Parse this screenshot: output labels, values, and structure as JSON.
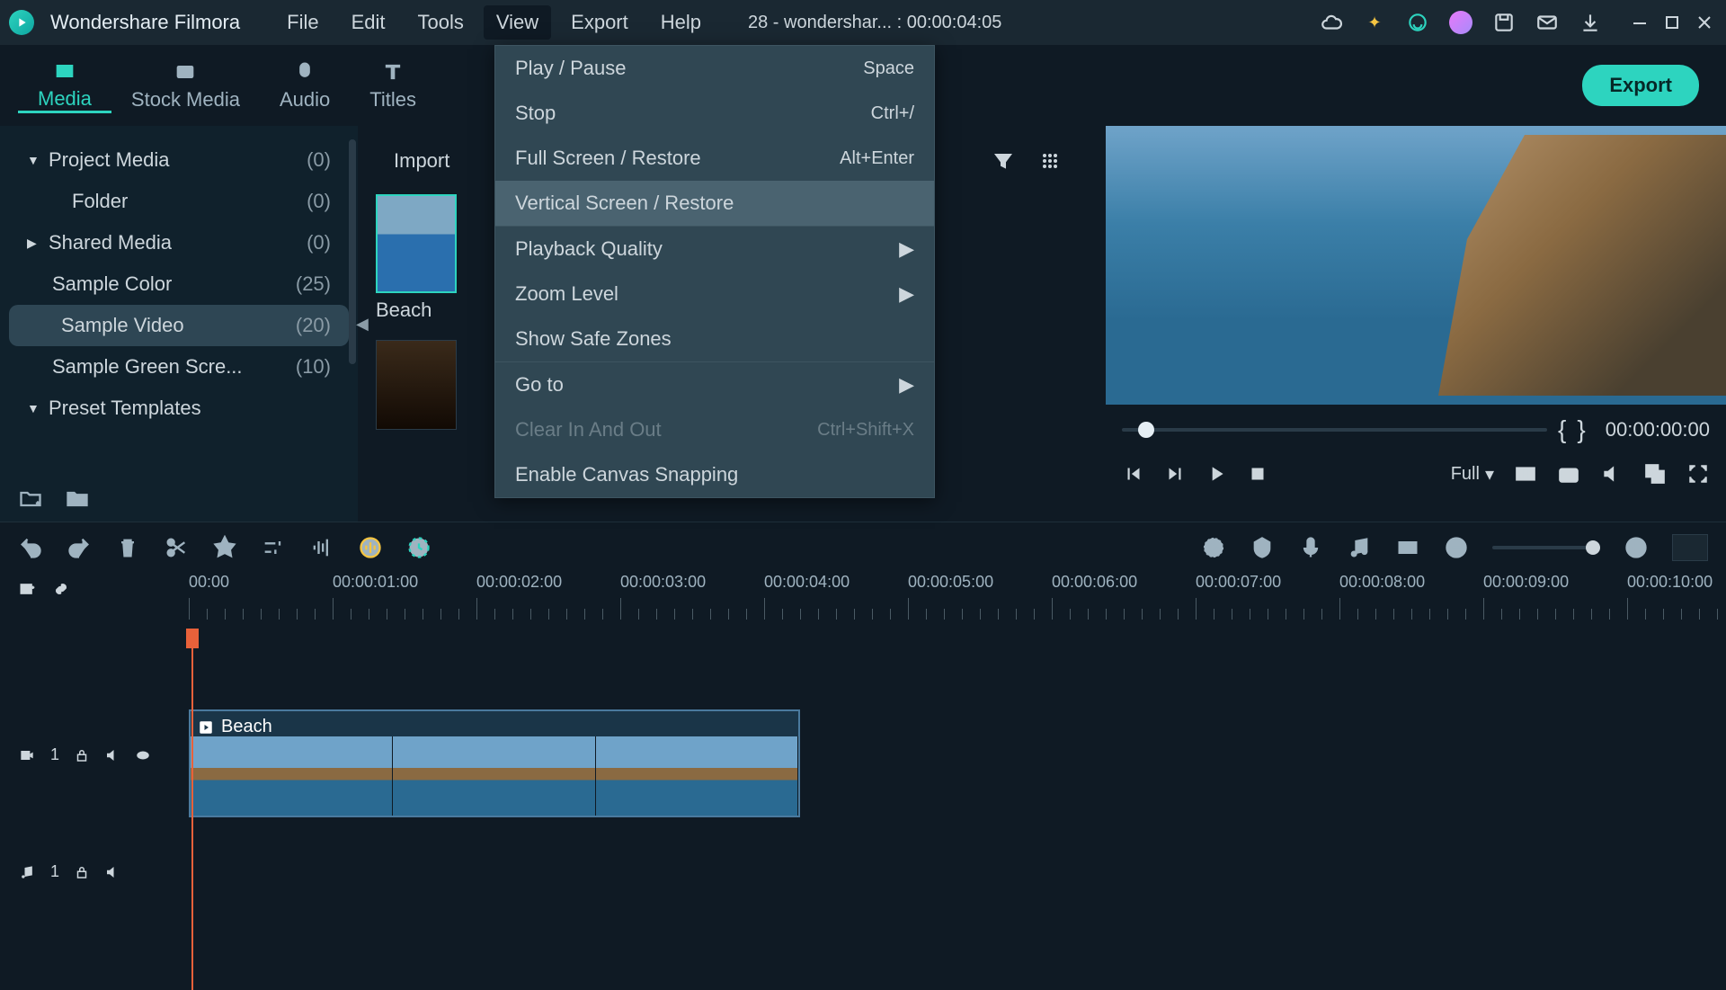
{
  "app": {
    "name": "Wondershare Filmora",
    "doc": "28 - wondershar... : 00:00:04:05"
  },
  "menubar": [
    "File",
    "Edit",
    "Tools",
    "View",
    "Export",
    "Help"
  ],
  "tabs": [
    {
      "label": "Media",
      "active": true
    },
    {
      "label": "Stock Media"
    },
    {
      "label": "Audio"
    },
    {
      "label": "Titles"
    }
  ],
  "export_label": "Export",
  "sidebar": {
    "items": [
      {
        "label": "Project Media",
        "count": "(0)",
        "arrow": "▼"
      },
      {
        "label": "Folder",
        "count": "(0)",
        "sub": true
      },
      {
        "label": "Shared Media",
        "count": "(0)",
        "arrow": "▶"
      },
      {
        "label": "Sample Color",
        "count": "(25)",
        "sub2": true
      },
      {
        "label": "Sample Video",
        "count": "(20)",
        "sub2": true,
        "selected": true
      },
      {
        "label": "Sample Green Scre...",
        "count": "(10)",
        "sub2": true
      },
      {
        "label": "Preset Templates",
        "arrow": "▼"
      }
    ]
  },
  "media": {
    "import": "Import",
    "thumb1": "Beach"
  },
  "dropdown": [
    {
      "label": "Play / Pause",
      "shortcut": "Space"
    },
    {
      "label": "Stop",
      "shortcut": "Ctrl+/"
    },
    {
      "label": "Full Screen / Restore",
      "shortcut": "Alt+Enter"
    },
    {
      "label": "Vertical Screen / Restore",
      "hover": true
    },
    {
      "sep": true
    },
    {
      "label": "Playback Quality",
      "submenu": true
    },
    {
      "label": "Zoom Level",
      "submenu": true
    },
    {
      "label": "Show Safe Zones"
    },
    {
      "sep": true
    },
    {
      "label": "Go to",
      "submenu": true
    },
    {
      "label": "Clear In And Out",
      "shortcut": "Ctrl+Shift+X",
      "disabled": true
    },
    {
      "label": "Enable Canvas Snapping"
    }
  ],
  "preview": {
    "timecode": "00:00:00:00",
    "quality": "Full"
  },
  "timeline": {
    "ticks": [
      "00:00",
      "00:00:01:00",
      "00:00:02:00",
      "00:00:03:00",
      "00:00:04:00",
      "00:00:05:00",
      "00:00:06:00",
      "00:00:07:00",
      "00:00:08:00",
      "00:00:09:00",
      "00:00:10:00"
    ],
    "clip": "Beach",
    "v_track": "1",
    "a_track": "1"
  }
}
